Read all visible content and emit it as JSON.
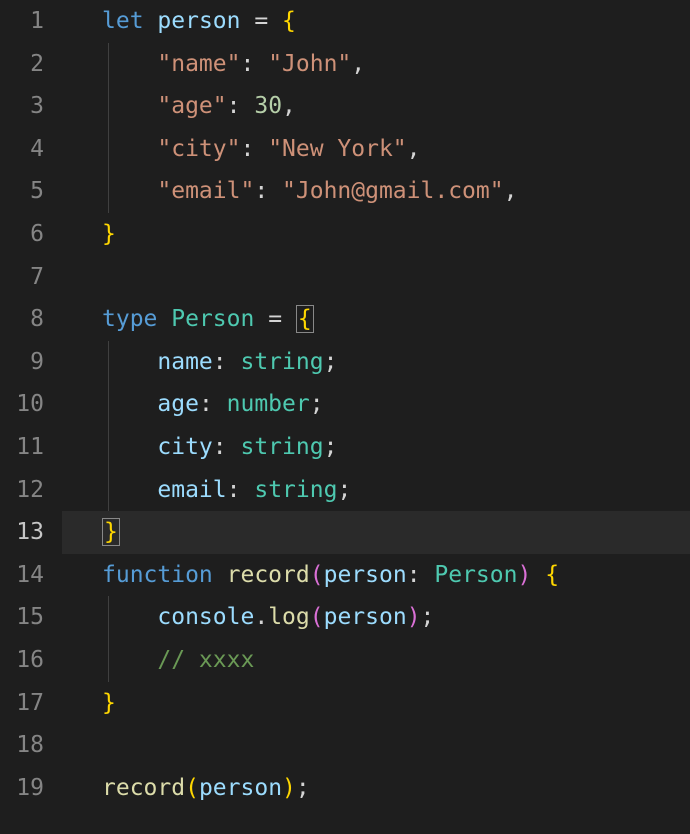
{
  "lines": {
    "count": 19,
    "active": 13
  },
  "code": {
    "l1": {
      "let": "let",
      "person": "person",
      "eq": " = ",
      "brace": "{"
    },
    "l2": {
      "key": "\"name\"",
      "colon": ": ",
      "val": "\"John\"",
      "comma": ","
    },
    "l3": {
      "key": "\"age\"",
      "colon": ": ",
      "val": "30",
      "comma": ","
    },
    "l4": {
      "key": "\"city\"",
      "colon": ": ",
      "val": "\"New York\"",
      "comma": ","
    },
    "l5": {
      "key": "\"email\"",
      "colon": ": ",
      "val": "\"John@gmail.com\"",
      "comma": ","
    },
    "l6": {
      "brace": "}"
    },
    "l8": {
      "type": "type",
      "name": "Person",
      "eq": " = ",
      "brace": "{"
    },
    "l9": {
      "prop": "name",
      "colon": ": ",
      "t": "string",
      "semi": ";"
    },
    "l10": {
      "prop": "age",
      "colon": ": ",
      "t": "number",
      "semi": ";"
    },
    "l11": {
      "prop": "city",
      "colon": ": ",
      "t": "string",
      "semi": ";"
    },
    "l12": {
      "prop": "email",
      "colon": ": ",
      "t": "string",
      "semi": ";"
    },
    "l13": {
      "brace": "}"
    },
    "l14": {
      "fn": "function",
      "name": "record",
      "lp": "(",
      "param": "person",
      "colon": ": ",
      "ptype": "Person",
      "rp": ")",
      "sp": " ",
      "brace": "{"
    },
    "l15": {
      "console": "console",
      "dot": ".",
      "log": "log",
      "lp": "(",
      "arg": "person",
      "rp": ")",
      "semi": ";"
    },
    "l16": {
      "comment": "// xxxx"
    },
    "l17": {
      "brace": "}"
    },
    "l19": {
      "name": "record",
      "lp": "(",
      "arg": "person",
      "rp": ")",
      "semi": ";"
    }
  }
}
